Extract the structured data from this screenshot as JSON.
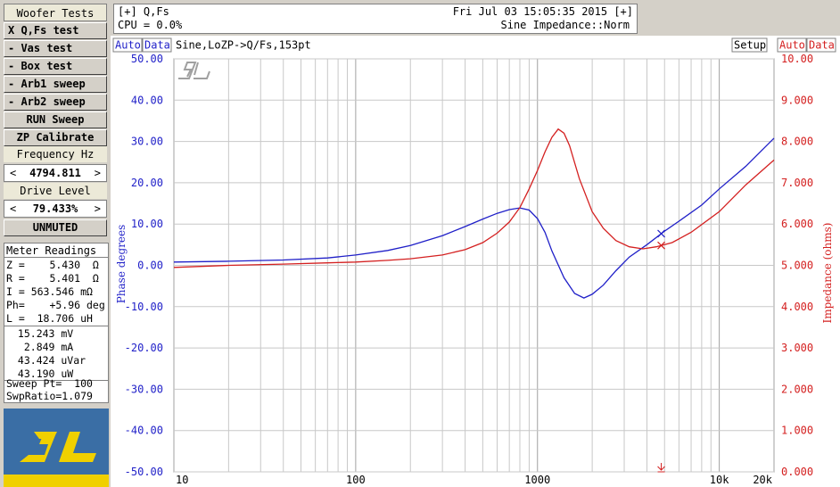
{
  "panel": {
    "title": "Woofer Tests",
    "buttons": [
      {
        "label": "X Q,Fs test",
        "active": true
      },
      {
        "label": "- Vas test"
      },
      {
        "label": "- Box test"
      },
      {
        "label": "- Arb1 sweep"
      },
      {
        "label": "- Arb2 sweep"
      },
      {
        "label": "RUN Sweep"
      },
      {
        "label": "ZP Calibrate"
      }
    ],
    "frequency_label": "Frequency Hz",
    "frequency_value": "4794.811",
    "drive_label": "Drive Level",
    "drive_value": "79.433%",
    "spin_left": "<",
    "spin_right": ">",
    "mute_button": "UNMUTED"
  },
  "meter": {
    "title": "Meter Readings",
    "rows": [
      "Z =    5.430  Ω",
      "R =    5.401  Ω",
      "I = 563.546 mΩ",
      "Ph=    +5.96 deg",
      "L =  18.706 uH"
    ],
    "rows2": [
      " 15.243 mV",
      "  2.849 mA",
      " 43.424 uVar",
      " 43.190 uW"
    ],
    "rows3": [
      "Sweep Pt=  100",
      "SwpRatio=1.079"
    ]
  },
  "topbar": {
    "left_top": "[+] Q,Fs",
    "right_top": "Fri Jul 03 15:05:35 2015 [+]",
    "left_bottom": "CPU = 0.0%",
    "right_bottom": "Sine Impedance::Norm"
  },
  "chart_header": {
    "auto_left": "Auto",
    "data_left": "Data",
    "title": "Sine,LoZP->Q/Fs,153pt",
    "setup": "Setup",
    "auto_right": "Auto",
    "data_right": "Data"
  },
  "colors": {
    "phase": "#1f1fc8",
    "impedance": "#d42020",
    "grid": "#c0c0c0"
  },
  "icons": [
    "sl-logo-icon",
    "cursor-x-icon",
    "cursor-marker-icon"
  ],
  "chart_data": {
    "type": "line",
    "xscale": "log",
    "xlim": [
      10,
      20000
    ],
    "x_ticks": [
      10,
      100,
      1000,
      10000,
      20000
    ],
    "x_tick_labels": [
      "10",
      "100",
      "1000",
      "10k",
      "20k"
    ],
    "ylabel_left": "Phase degrees",
    "ylim_left": [
      -50,
      50
    ],
    "y_ticks_left": [
      "50.00",
      "40.00",
      "30.00",
      "20.00",
      "10.00",
      "0.00",
      "-10.00",
      "-20.00",
      "-30.00",
      "-40.00",
      "-50.00"
    ],
    "ylabel_right": "Impedance (ohms)",
    "ylim_right": [
      0,
      10
    ],
    "y_ticks_right": [
      "10.00",
      "9.000",
      "8.000",
      "7.000",
      "6.000",
      "5.000",
      "4.000",
      "3.000",
      "2.000",
      "1.000",
      "0.000"
    ],
    "cursor_x": 4794.811,
    "series": [
      {
        "name": "Phase degrees",
        "axis": "left",
        "x": [
          10,
          20,
          40,
          70,
          100,
          150,
          200,
          300,
          400,
          500,
          600,
          700,
          800,
          900,
          1000,
          1100,
          1200,
          1400,
          1600,
          1800,
          2000,
          2300,
          2700,
          3200,
          4000,
          5000,
          6000,
          8000,
          10000,
          14000,
          20000
        ],
        "y": [
          0.8,
          1.0,
          1.3,
          1.8,
          2.5,
          3.6,
          4.8,
          7.2,
          9.4,
          11.2,
          12.6,
          13.5,
          13.9,
          13.4,
          11.3,
          8.0,
          3.5,
          -3.0,
          -6.8,
          -7.9,
          -7.0,
          -4.8,
          -1.3,
          2.0,
          5.0,
          8.3,
          10.7,
          14.6,
          18.5,
          24.0,
          30.8
        ]
      },
      {
        "name": "Impedance (ohms)",
        "axis": "right",
        "x": [
          10,
          20,
          40,
          70,
          100,
          150,
          200,
          300,
          400,
          500,
          600,
          700,
          800,
          900,
          1000,
          1100,
          1200,
          1300,
          1400,
          1500,
          1700,
          2000,
          2300,
          2700,
          3200,
          3800,
          4500,
          5500,
          7000,
          10000,
          14000,
          20000
        ],
        "y": [
          4.95,
          5.0,
          5.03,
          5.06,
          5.08,
          5.12,
          5.16,
          5.25,
          5.38,
          5.55,
          5.78,
          6.05,
          6.4,
          6.85,
          7.3,
          7.75,
          8.1,
          8.3,
          8.2,
          7.9,
          7.1,
          6.3,
          5.9,
          5.6,
          5.45,
          5.4,
          5.45,
          5.55,
          5.8,
          6.3,
          6.95,
          7.55
        ]
      }
    ]
  }
}
